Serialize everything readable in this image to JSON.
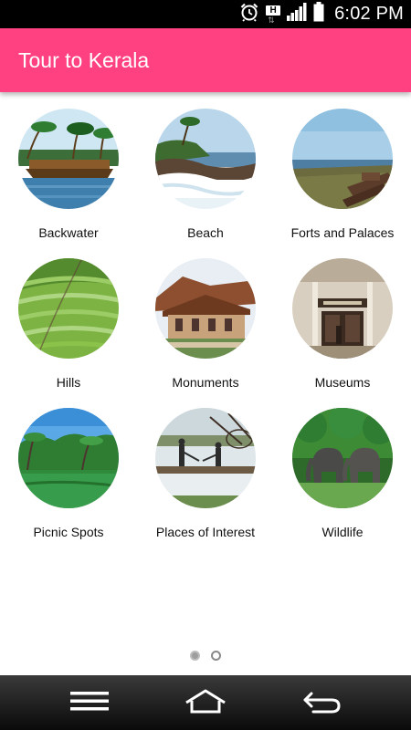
{
  "status_bar": {
    "time": "6:02 PM",
    "network_badge": "H",
    "icons": [
      "alarm-clock-icon",
      "network-h-icon",
      "signal-icon",
      "battery-icon"
    ]
  },
  "app_bar": {
    "title": "Tour to Kerala",
    "color": "#ff4081"
  },
  "categories": [
    {
      "label": "Backwater",
      "image": "houseboat-backwater-photo"
    },
    {
      "label": "Beach",
      "image": "beach-rocks-waves-photo"
    },
    {
      "label": "Forts and Palaces",
      "image": "fort-coast-photo"
    },
    {
      "label": "Hills",
      "image": "tea-plantation-hills-photo"
    },
    {
      "label": "Monuments",
      "image": "traditional-building-photo"
    },
    {
      "label": "Museums",
      "image": "museum-entrance-photo"
    },
    {
      "label": "Picnic Spots",
      "image": "palm-lagoon-photo"
    },
    {
      "label": "Places of Interest",
      "image": "chinese-fishing-nets-photo"
    },
    {
      "label": "Wildlife",
      "image": "elephants-photo"
    }
  ],
  "pager": {
    "current_page": 1,
    "total_pages": 2
  },
  "nav_bar": {
    "icons": [
      "menu-icon",
      "home-icon",
      "back-icon"
    ]
  }
}
